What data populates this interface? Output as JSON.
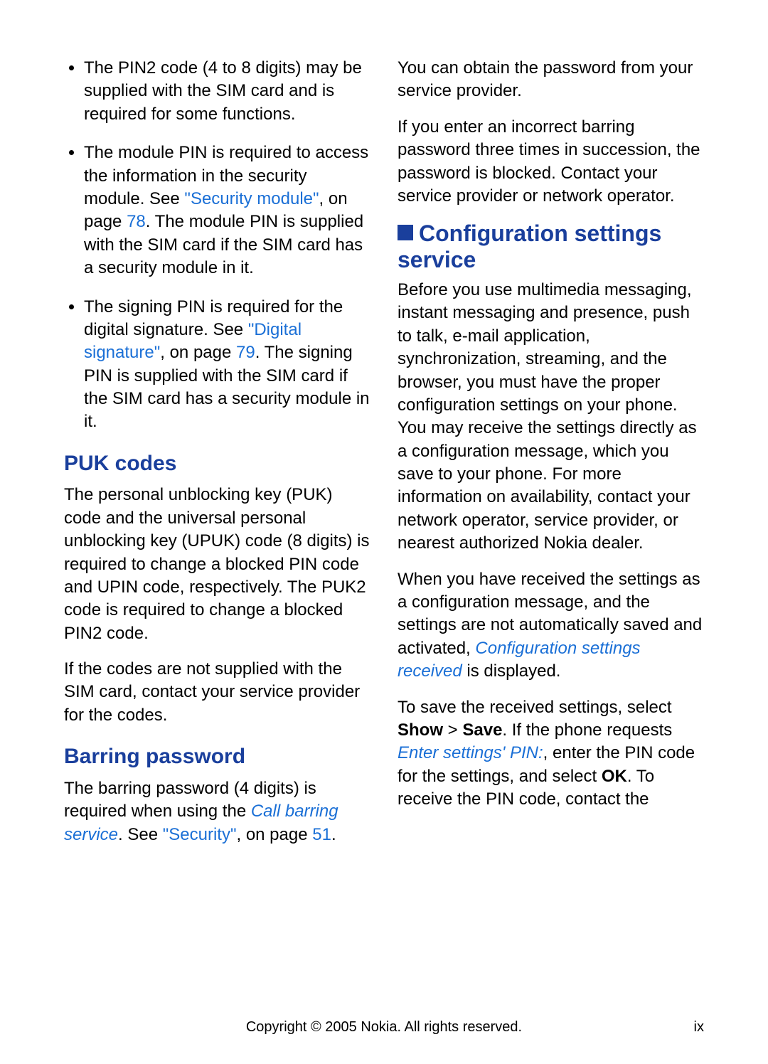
{
  "col1": {
    "bullets": [
      {
        "text": "The PIN2 code (4 to 8 digits) may be supplied with the SIM card and is required for some functions."
      },
      {
        "pre": "The module PIN is required to access the information in the security module. See ",
        "link": "\"Security module\"",
        "mid": ", on page ",
        "page": "78",
        "post": ". The module PIN is supplied with the SIM card if the SIM card has a security module in it."
      },
      {
        "pre": "The signing PIN is required for the digital signature. See ",
        "link": "\"Digital signature\"",
        "mid": ", on page ",
        "page": "79",
        "post": ". The signing PIN is supplied with the SIM card if the SIM card has a security module in it."
      }
    ],
    "puk_heading": "PUK codes",
    "puk_p1": "The personal unblocking key (PUK) code and the universal personal unblocking key (UPUK) code (8 digits) is required to change a blocked PIN code and UPIN code, respectively. The PUK2 code is required to change a blocked PIN2 code.",
    "puk_p2": "If the codes are not supplied with the SIM card, contact your service provider for the codes.",
    "barring_heading": "Barring password",
    "barring_pre": "The barring password (4 digits) is required when using the ",
    "barring_em": "Call barring service",
    "barring_mid": ". See ",
    "barring_link": "\"Security\"",
    "barring_mid2": ", on page ",
    "barring_page": "51",
    "barring_post": "."
  },
  "col2": {
    "p1": "You can obtain the password from your service provider.",
    "p2": "If you enter an incorrect barring password three times in succession, the password is blocked. Contact your service provider or network operator.",
    "conf_heading": "Configuration settings service",
    "conf_p1": "Before you use multimedia messaging, instant messaging and presence, push to talk, e-mail application, synchronization, streaming, and the browser, you must have the proper configuration settings on your phone. You may receive the settings directly as a configuration message, which you save to your phone. For more information on availability, contact your network operator, service provider, or nearest authorized Nokia dealer.",
    "conf_p2_pre": "When you have received the settings as a configuration message, and the settings are not automatically saved and activated, ",
    "conf_p2_em": "Configuration settings received",
    "conf_p2_post": " is displayed.",
    "conf_p3_pre": "To save the received settings, select ",
    "conf_p3_b1": "Show",
    "conf_p3_gt": " > ",
    "conf_p3_b2": "Save",
    "conf_p3_mid1": ". If the phone requests ",
    "conf_p3_em": "Enter settings' PIN:",
    "conf_p3_mid2": ", enter the PIN code for the settings, and select ",
    "conf_p3_b3": "OK",
    "conf_p3_post": ". To receive the PIN code, contact the"
  },
  "footer": {
    "copyright": "Copyright © 2005 Nokia. All rights reserved.",
    "page": "ix"
  }
}
